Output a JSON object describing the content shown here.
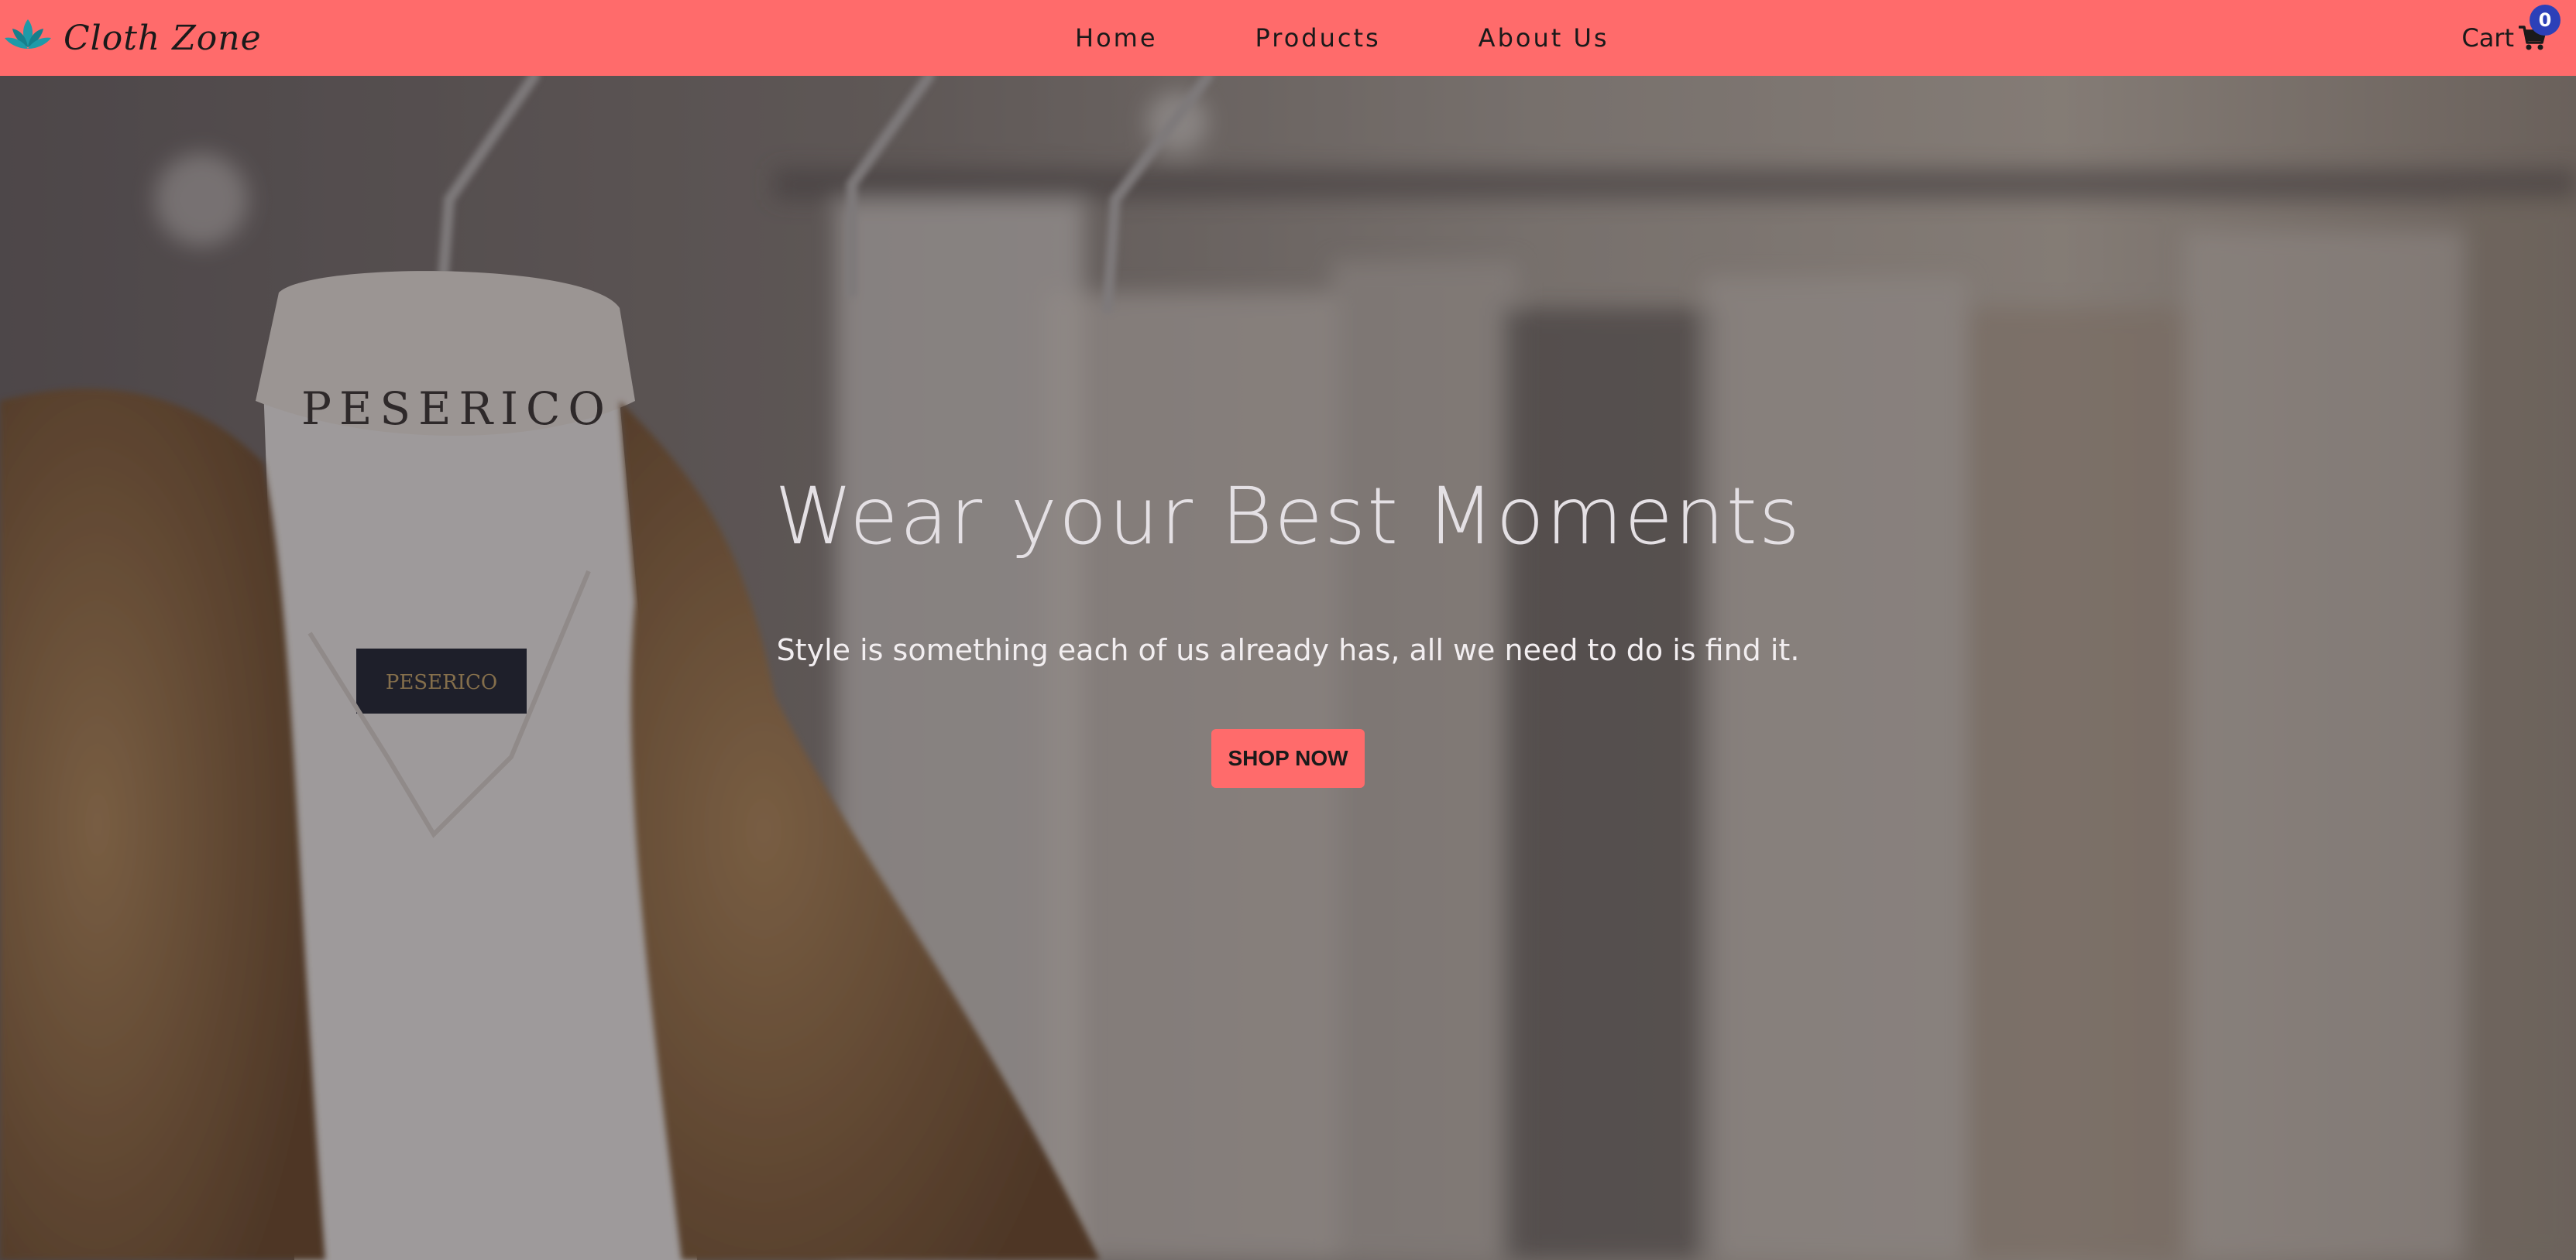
{
  "navbar": {
    "brand_name": "Cloth Zone",
    "brand_icon": "lotus-icon",
    "links": [
      {
        "label": "Home"
      },
      {
        "label": "Products"
      },
      {
        "label": "About Us"
      }
    ],
    "cart": {
      "label": "Cart",
      "icon": "shopping-cart-icon",
      "count": "0"
    }
  },
  "hero": {
    "title": "Wear your Best Moments",
    "subtitle": "Style is something each of us already has, all we need to do is find it.",
    "cta_label": "SHOP NOW",
    "background_description_icon": "clothing-rack-photo"
  },
  "colors": {
    "accent": "#ff6b6b",
    "badge": "#2c40b8",
    "logo": "#1e9aa8"
  }
}
